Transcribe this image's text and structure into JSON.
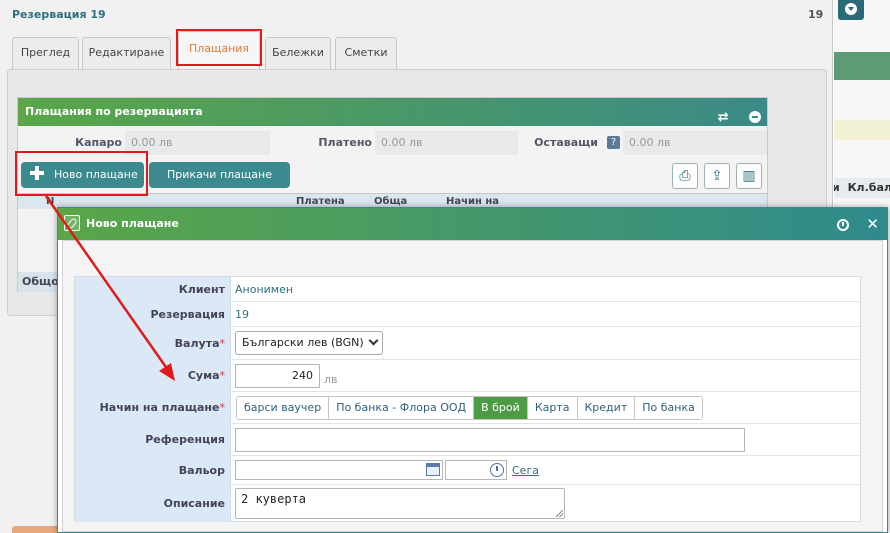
{
  "reservation": {
    "title": "Резервация 19",
    "number": "19"
  },
  "tabs": [
    {
      "label": "Преглед"
    },
    {
      "label": "Редактиране"
    },
    {
      "label": "Плащания"
    },
    {
      "label": "Бележки"
    },
    {
      "label": "Сметки"
    }
  ],
  "payments_panel": {
    "title": "Плащания по резервацията",
    "summary": [
      {
        "label": "Капаро",
        "value": "0.00 лв"
      },
      {
        "label": "Платено",
        "value": "0.00 лв"
      },
      {
        "label": "Оставащи",
        "value": "0.00 лв"
      }
    ],
    "new_payment_button": "Ново плащане",
    "attach_payment_button": "Прикачи плащане",
    "grid_headers": [
      "N",
      "Платена",
      "Обща",
      "Начин на"
    ],
    "grid_footer": "Общо"
  },
  "right_fragments": {
    "column_header": "Кл.бал",
    "col_prefix": "и"
  },
  "modal": {
    "title": "Ново плащане",
    "fields": {
      "client": {
        "label": "Клиент",
        "value": "Анонимен"
      },
      "reservation": {
        "label": "Резервация",
        "value": "19"
      },
      "currency": {
        "label": "Валута",
        "value": "Български лев (BGN)"
      },
      "amount": {
        "label": "Сума",
        "value": "240",
        "unit": "лв"
      },
      "payment_method": {
        "label": "Начин на плащане",
        "options": [
          "барси ваучер",
          "По банка - Флора ООД",
          "В брой",
          "Карта",
          "Кредит",
          "По банка"
        ],
        "selected": "В брой"
      },
      "reference": {
        "label": "Референция",
        "value": ""
      },
      "value_date": {
        "label": "Вальор",
        "date": "",
        "time": "",
        "now_link": "Сега"
      },
      "description": {
        "label": "Описание",
        "value": "2 куверта"
      }
    }
  },
  "colors": {
    "header_gradient_start": "#5aa648",
    "header_gradient_end": "#3a8a87",
    "active_tab_text": "#e07b39",
    "active_method": "#4e9b45",
    "annotation_red": "#e01b1b"
  }
}
